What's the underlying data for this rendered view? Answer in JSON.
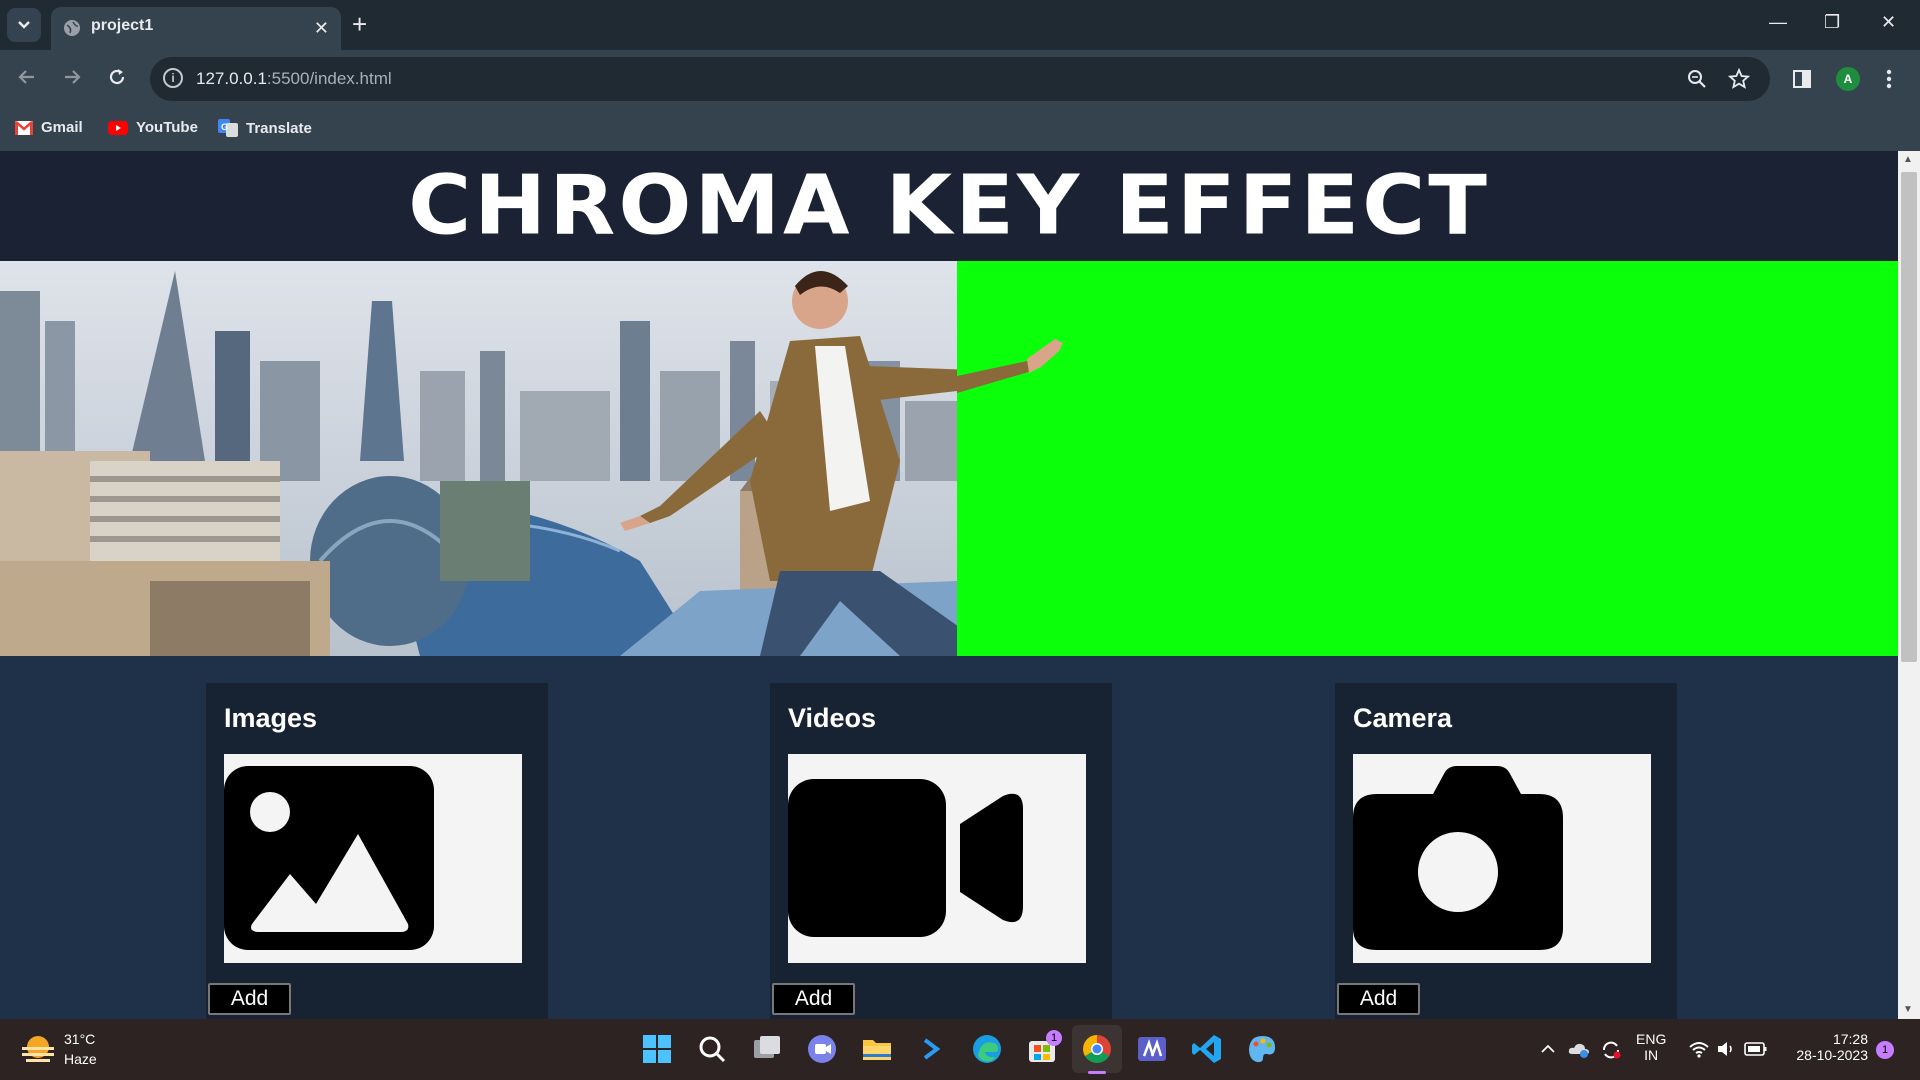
{
  "browser": {
    "tab_title": "project1",
    "tab_close": "✕",
    "new_tab": "+",
    "url_host": "127.0.0.1",
    "url_path": ":5500/index.html",
    "window_controls": [
      "—",
      "❐",
      "✕"
    ],
    "profile_initial": "A",
    "bookmarks": [
      {
        "label": "Gmail",
        "icon": "gmail-icon"
      },
      {
        "label": "YouTube",
        "icon": "youtube-icon"
      },
      {
        "label": "Translate",
        "icon": "translate-icon"
      }
    ]
  },
  "page": {
    "title": "CHROMA KEY EFFECT",
    "cards": [
      {
        "heading": "Images",
        "button": "Add",
        "icon": "image-icon"
      },
      {
        "heading": "Videos",
        "button": "Add",
        "icon": "video-camera-icon"
      },
      {
        "heading": "Camera",
        "button": "Add",
        "icon": "camera-icon"
      }
    ],
    "colors": {
      "green_screen": "#0bff0b",
      "header_bg": "#1a2233",
      "page_bg": "#1f3149"
    }
  },
  "taskbar": {
    "weather_temp": "31°C",
    "weather_condition": "Haze",
    "language": "ENG",
    "region": "IN",
    "time": "17:28",
    "date": "28-10-2023",
    "notification_count": "1",
    "store_badge": "1"
  }
}
